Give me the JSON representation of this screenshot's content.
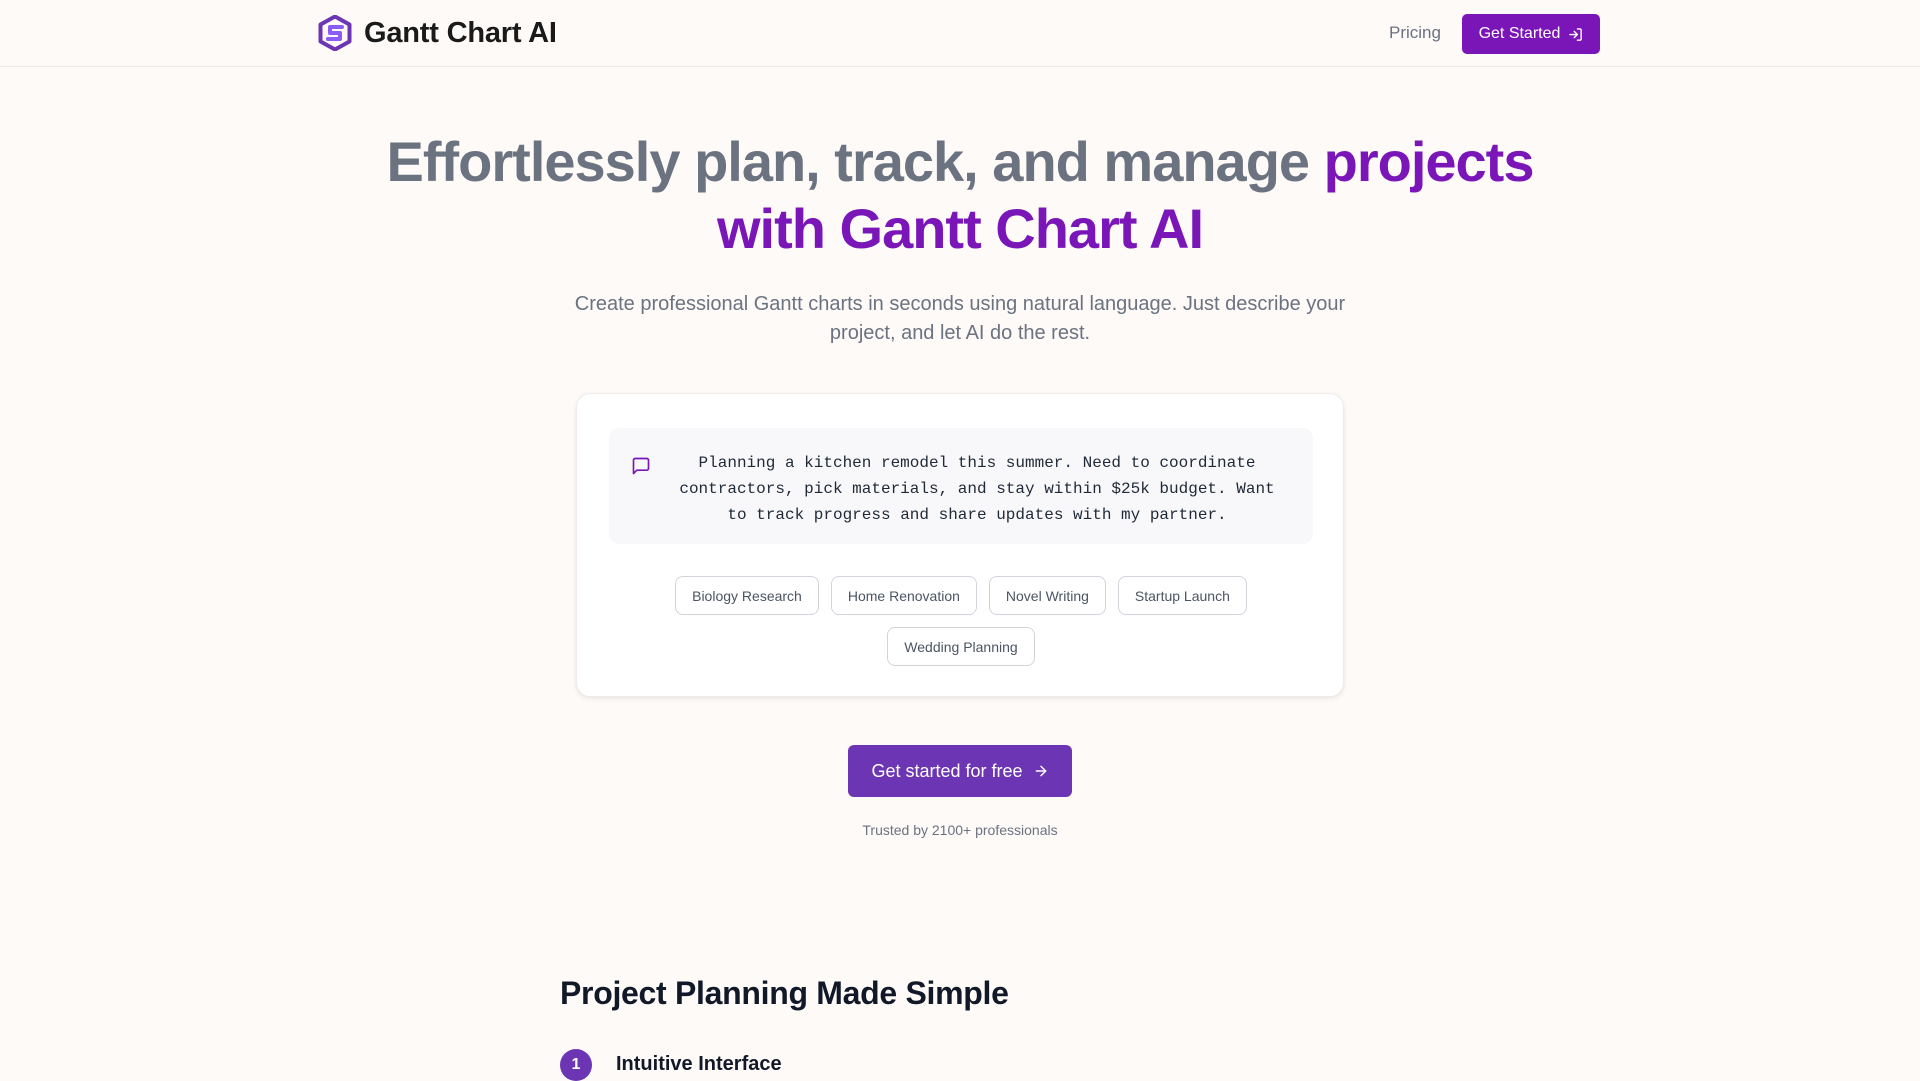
{
  "colors": {
    "brand": "#7a16b8",
    "cta": "#6b35b4",
    "muted": "#6b7280",
    "background": "#fdfaf8"
  },
  "header": {
    "brand_name": "Gantt Chart AI",
    "logo_icon": "hexagon-s-logo-icon",
    "nav_pricing": "Pricing",
    "cta_label": "Get Started",
    "cta_icon": "log-in-icon"
  },
  "hero": {
    "title_plain": "Effortlessly plan, track, and manage ",
    "title_accent": "projects with Gantt Chart AI",
    "subtitle": "Create professional Gantt charts in seconds using natural language. Just describe your project, and let AI do the rest."
  },
  "prompt_card": {
    "icon": "message-square-icon",
    "text": "Planning a kitchen remodel this summer. Need to coordinate contractors, pick materials, and stay within $25k budget. Want to track progress and share updates with my partner.",
    "chips": [
      "Biology Research",
      "Home Renovation",
      "Novel Writing",
      "Startup Launch",
      "Wedding Planning"
    ]
  },
  "cta": {
    "label": "Get started for free",
    "icon": "arrow-right-icon",
    "trusted": "Trusted by 2100+ professionals"
  },
  "features": {
    "title": "Project Planning Made Simple",
    "items": [
      {
        "number": "1",
        "title": "Intuitive Interface"
      }
    ]
  }
}
